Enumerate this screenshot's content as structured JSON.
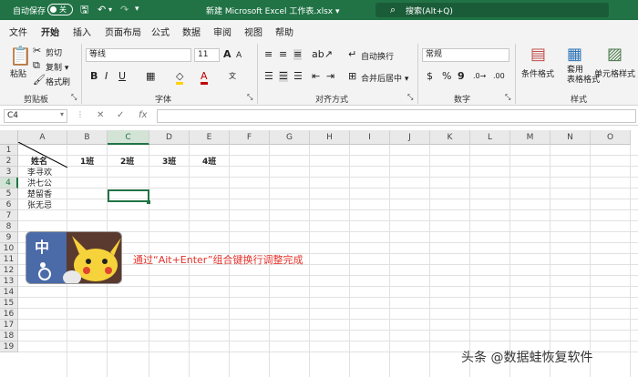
{
  "titlebar": {
    "autosave_label": "自动保存",
    "autosave_state": "关",
    "doc_title": "新建 Microsoft Excel 工作表.xlsx ▾",
    "search_placeholder": "搜索(Alt+Q)"
  },
  "menu": [
    "文件",
    "开始",
    "插入",
    "页面布局",
    "公式",
    "数据",
    "审阅",
    "视图",
    "帮助"
  ],
  "ribbon": {
    "clipboard": {
      "paste": "粘贴",
      "cut": "剪切",
      "copy": "复制 ▾",
      "format_painter": "格式刷",
      "label": "剪贴板"
    },
    "font": {
      "name": "等线",
      "size": "11",
      "label": "字体"
    },
    "alignment": {
      "wrap_text": "自动换行",
      "merge_center": "合并后居中 ▾",
      "label": "对齐方式"
    },
    "number": {
      "format": "常规",
      "label": "数字"
    },
    "styles": {
      "conditional": "条件格式",
      "table_format": "套用\n表格格式",
      "cell_styles": "单元格样式",
      "label": "样式"
    }
  },
  "formula_bar": {
    "name_box": "C4",
    "fx": "fx",
    "cancel": "✕",
    "confirm": "✓"
  },
  "sheet": {
    "columns": [
      "A",
      "B",
      "C",
      "D",
      "E",
      "F",
      "G",
      "H",
      "I",
      "J",
      "K",
      "L",
      "M",
      "N",
      "O"
    ],
    "rows": [
      "1",
      "2",
      "3",
      "4",
      "5",
      "6",
      "7",
      "8",
      "9",
      "10",
      "11",
      "12",
      "13",
      "14",
      "15",
      "16",
      "17",
      "18",
      "19"
    ],
    "header_row": {
      "A1": "姓名",
      "B1": "1班",
      "C1": "2班",
      "D1": "3班",
      "E1": "4班"
    },
    "names": [
      "李寻欢",
      "洪七公",
      "楚留香",
      "张无忌"
    ],
    "selected_cell": "C4"
  },
  "annotation": "通过“Ait+Enter”组合键换行调整完成",
  "watermark": "头条 @数据蛙恢复软件",
  "colors": {
    "excel_green": "#217346",
    "annotation_red": "#e4322b"
  }
}
